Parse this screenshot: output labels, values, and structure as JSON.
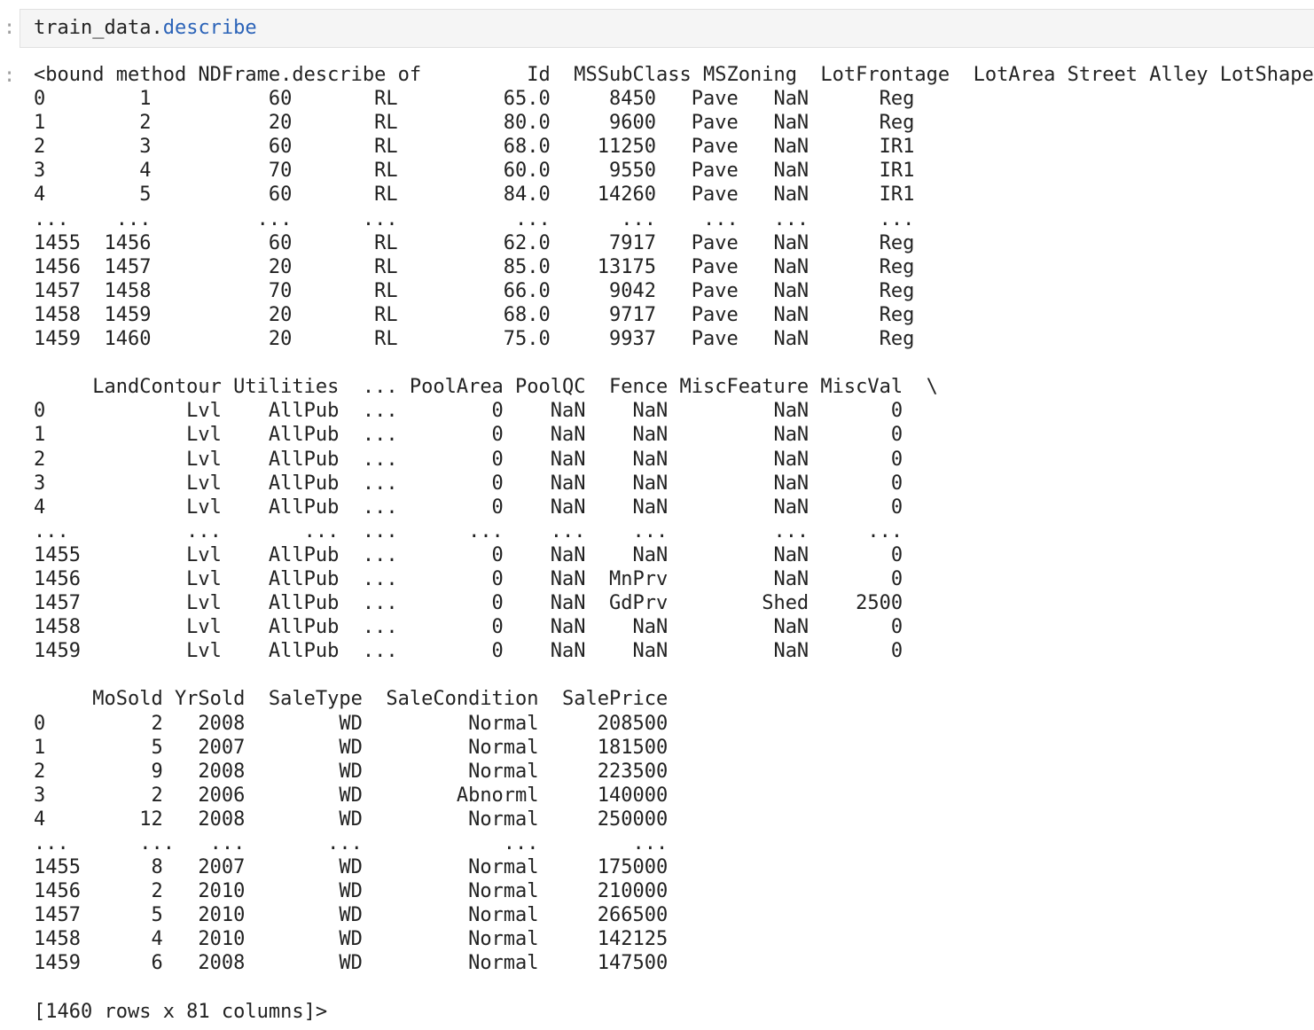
{
  "notebook": {
    "input_prompt": ":",
    "output_prompt": ":",
    "code": {
      "variable": "train_data",
      "dot": ".",
      "attribute": "describe"
    },
    "output_lines": [
      "<bound method NDFrame.describe of         Id  MSSubClass MSZoning  LotFrontage  LotArea Street Alley LotShape  \\",
      "0        1          60       RL         65.0     8450   Pave   NaN      Reg   ",
      "1        2          20       RL         80.0     9600   Pave   NaN      Reg   ",
      "2        3          60       RL         68.0    11250   Pave   NaN      IR1   ",
      "3        4          70       RL         60.0     9550   Pave   NaN      IR1   ",
      "4        5          60       RL         84.0    14260   Pave   NaN      IR1   ",
      "...    ...         ...      ...          ...      ...    ...   ...      ...   ",
      "1455  1456          60       RL         62.0     7917   Pave   NaN      Reg   ",
      "1456  1457          20       RL         85.0    13175   Pave   NaN      Reg   ",
      "1457  1458          70       RL         66.0     9042   Pave   NaN      Reg   ",
      "1458  1459          20       RL         68.0     9717   Pave   NaN      Reg   ",
      "1459  1460          20       RL         75.0     9937   Pave   NaN      Reg   ",
      "",
      "     LandContour Utilities  ... PoolArea PoolQC  Fence MiscFeature MiscVal  \\",
      "0            Lvl    AllPub  ...        0    NaN    NaN         NaN       0   ",
      "1            Lvl    AllPub  ...        0    NaN    NaN         NaN       0   ",
      "2            Lvl    AllPub  ...        0    NaN    NaN         NaN       0   ",
      "3            Lvl    AllPub  ...        0    NaN    NaN         NaN       0   ",
      "4            Lvl    AllPub  ...        0    NaN    NaN         NaN       0   ",
      "...          ...       ...  ...      ...    ...    ...         ...     ...   ",
      "1455         Lvl    AllPub  ...        0    NaN    NaN         NaN       0   ",
      "1456         Lvl    AllPub  ...        0    NaN  MnPrv         NaN       0   ",
      "1457         Lvl    AllPub  ...        0    NaN  GdPrv        Shed    2500   ",
      "1458         Lvl    AllPub  ...        0    NaN    NaN         NaN       0   ",
      "1459         Lvl    AllPub  ...        0    NaN    NaN         NaN       0   ",
      "",
      "     MoSold YrSold  SaleType  SaleCondition  SalePrice  ",
      "0         2   2008        WD         Normal     208500  ",
      "1         5   2007        WD         Normal     181500  ",
      "2         9   2008        WD         Normal     223500  ",
      "3         2   2006        WD        Abnorml     140000  ",
      "4        12   2008        WD         Normal     250000  ",
      "...      ...   ...       ...            ...        ...  ",
      "1455      8   2007        WD         Normal     175000  ",
      "1456      2   2010        WD         Normal     210000  ",
      "1457      5   2010        WD         Normal     266500  ",
      "1458      4   2010        WD         Normal     142125  ",
      "1459      6   2008        WD         Normal     147500  ",
      "",
      "[1460 rows x 81 columns]>"
    ]
  },
  "colors": {
    "attribute": "#2b63b8",
    "prompt": "#9e9e9e",
    "input_background": "#f5f5f5"
  }
}
